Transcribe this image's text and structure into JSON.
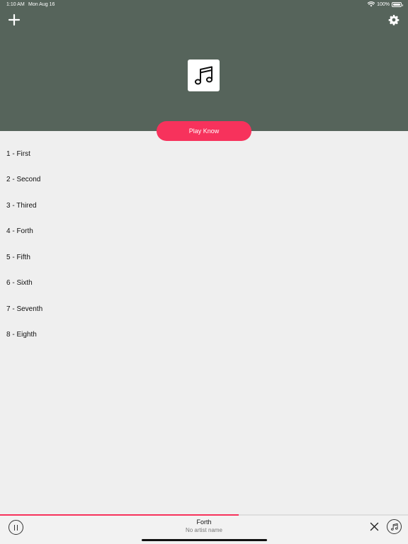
{
  "status_bar": {
    "time": "1:10 AM",
    "date": "Mon Aug 16",
    "battery": "100%",
    "icons": [
      "wifi-icon",
      "battery-icon"
    ]
  },
  "header": {
    "background": "#56645b",
    "add_icon": "plus-icon",
    "settings_icon": "gear-icon",
    "artwork_icon": "music-note-icon"
  },
  "play_button": {
    "label": "Play Know",
    "color": "#f7325c"
  },
  "tracks": [
    {
      "label": "1 - First"
    },
    {
      "label": "2 - Second"
    },
    {
      "label": "3 - Thired"
    },
    {
      "label": "4 - Forth"
    },
    {
      "label": "5 - Fifth"
    },
    {
      "label": "6 - Sixth"
    },
    {
      "label": "7 - Seventh"
    },
    {
      "label": "8 - Eighth"
    }
  ],
  "mini_player": {
    "title": "Forth",
    "artist": "No artist name",
    "progress_fraction": 0.585,
    "accent": "#f7325c",
    "icons": [
      "pause-icon",
      "close-icon",
      "music-note-icon"
    ]
  }
}
